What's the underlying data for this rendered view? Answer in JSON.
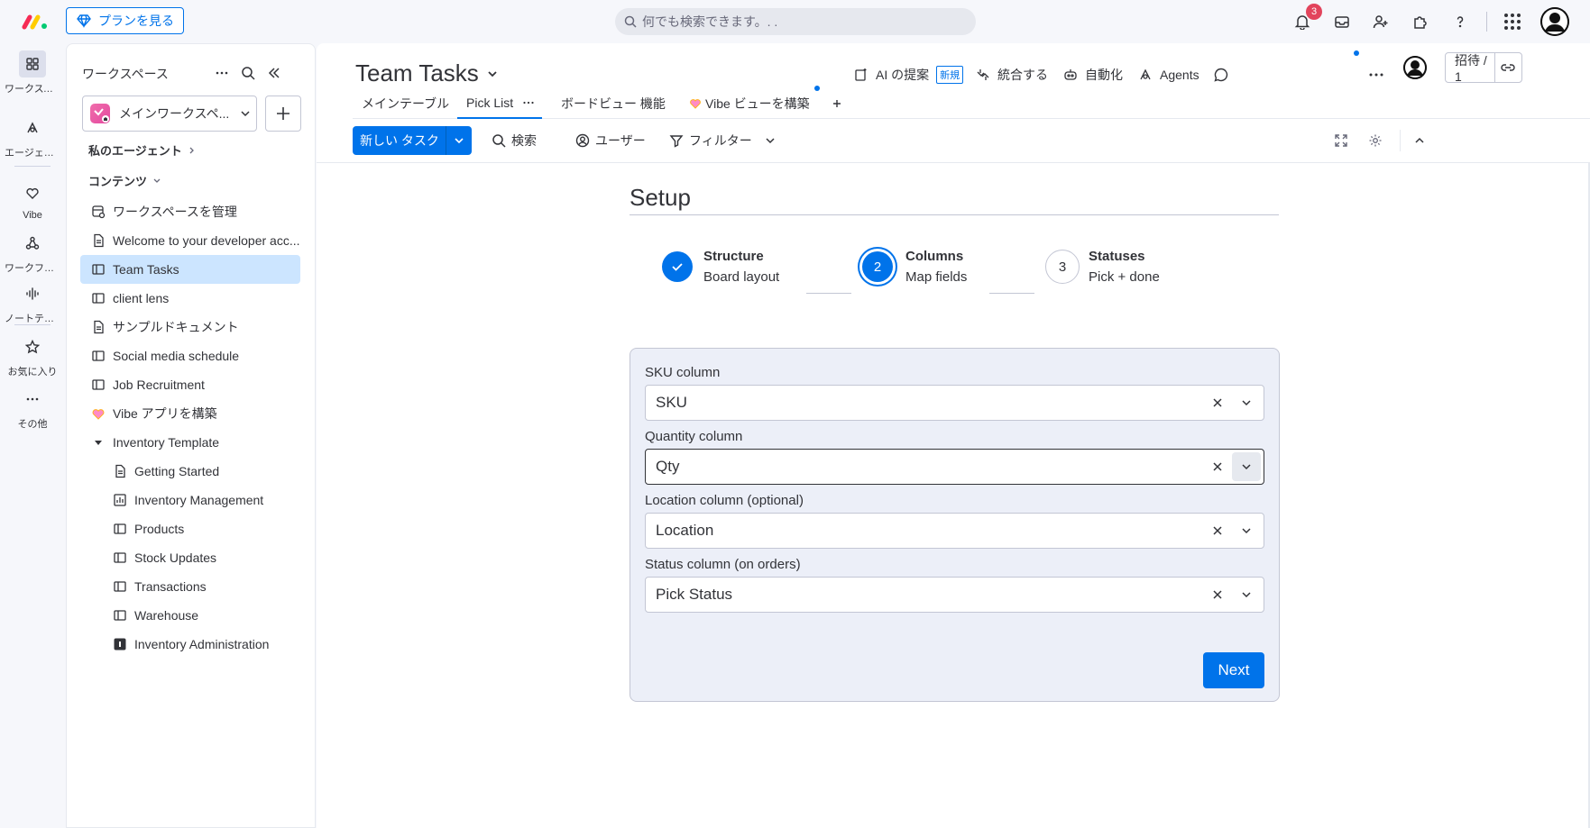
{
  "topbar": {
    "plans_label": "プランを見る",
    "search_placeholder": "何でも検索できます。. .",
    "notification_count": "3"
  },
  "rail": {
    "items": [
      {
        "label": "ワークスペース"
      },
      {
        "label": "エージェント"
      },
      {
        "label": "Vibe"
      },
      {
        "label": "ワークフロー"
      },
      {
        "label": "ノートテイカー"
      },
      {
        "label": "お気に入り"
      },
      {
        "label": "その他"
      }
    ]
  },
  "sidebar": {
    "title": "ワークスペース",
    "workspace_name": "メインワークスペ...",
    "my_agents": "私のエージェント",
    "contents": "コンテンツ",
    "items": [
      {
        "label": "ワークスペースを管理",
        "icon": "manage-icon"
      },
      {
        "label": "Welcome to your developer acc...",
        "icon": "doc-icon"
      },
      {
        "label": "Team Tasks",
        "icon": "board-icon"
      },
      {
        "label": "client lens",
        "icon": "board-icon"
      },
      {
        "label": "サンプルドキュメント",
        "icon": "doc-icon"
      },
      {
        "label": "Social media schedule",
        "icon": "board-icon"
      },
      {
        "label": "Job Recruitment",
        "icon": "board-icon"
      },
      {
        "label": "Vibe アプリを構築",
        "icon": "vibe-icon"
      },
      {
        "label": "Inventory Template",
        "icon": "caret-icon"
      },
      {
        "label": "Getting Started",
        "icon": "doc-icon"
      },
      {
        "label": "Inventory Management",
        "icon": "dashboard-icon"
      },
      {
        "label": "Products",
        "icon": "board-icon"
      },
      {
        "label": "Stock Updates",
        "icon": "board-icon"
      },
      {
        "label": "Transactions",
        "icon": "board-icon"
      },
      {
        "label": "Warehouse",
        "icon": "board-icon"
      },
      {
        "label": "Inventory Administration",
        "icon": "app-icon"
      }
    ]
  },
  "header": {
    "board_title": "Team Tasks",
    "ai_label": "AI の提案",
    "new_badge": "新規",
    "integrate_label": "統合する",
    "automate_label": "自動化",
    "agents_label": "Agents",
    "invite_label": "招待 / 1"
  },
  "tabs": [
    {
      "label": "メインテーブル"
    },
    {
      "label": "Pick List"
    },
    {
      "label": "ボードビュー 機能"
    },
    {
      "label": "Vibe ビューを構築"
    }
  ],
  "toolbar": {
    "new_task": "新しい タスク",
    "search": "検索",
    "user": "ユーザー",
    "filter": "フィルター"
  },
  "setup": {
    "title": "Setup",
    "steps": [
      {
        "title": "Structure",
        "subtitle": "Board layout",
        "state": "done"
      },
      {
        "number": "2",
        "title": "Columns",
        "subtitle": "Map fields",
        "state": "current"
      },
      {
        "number": "3",
        "title": "Statuses",
        "subtitle": "Pick + done",
        "state": "pending"
      }
    ],
    "fields": [
      {
        "label": "SKU column",
        "value": "SKU"
      },
      {
        "label": "Quantity column",
        "value": "Qty"
      },
      {
        "label": "Location column (optional)",
        "value": "Location"
      },
      {
        "label": "Status column (on orders)",
        "value": "Pick Status"
      }
    ],
    "next_label": "Next"
  },
  "colors": {
    "accent": "#0073ea",
    "active_sidebar": "#cce5ff",
    "badge_red": "#e2445c",
    "card_bg": "#eceff8"
  }
}
